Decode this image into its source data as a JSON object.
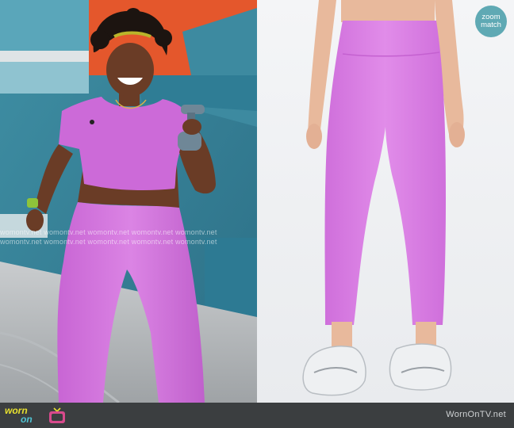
{
  "left_panel": {
    "watermark_line_1": "womontv.net  womontv.net  womontv.net  womontv.net  womontv.net",
    "watermark_line_2": "womontv.net  womontv.net  womontv.net  womontv.net  womontv.net"
  },
  "expand_button": {
    "line_1": "zoom",
    "line_2": "match",
    "color": "#5fa9b4"
  },
  "footer": {
    "brand_word_1": "worn",
    "brand_word_2": "on",
    "tv_icon": "tv-icon",
    "url": "WornOnTV.net",
    "bar_color": "#3b3e40"
  },
  "colors": {
    "leggings": "#d77fe1",
    "brand_yellow": "#e7e02f",
    "brand_teal": "#4fc3d3"
  }
}
